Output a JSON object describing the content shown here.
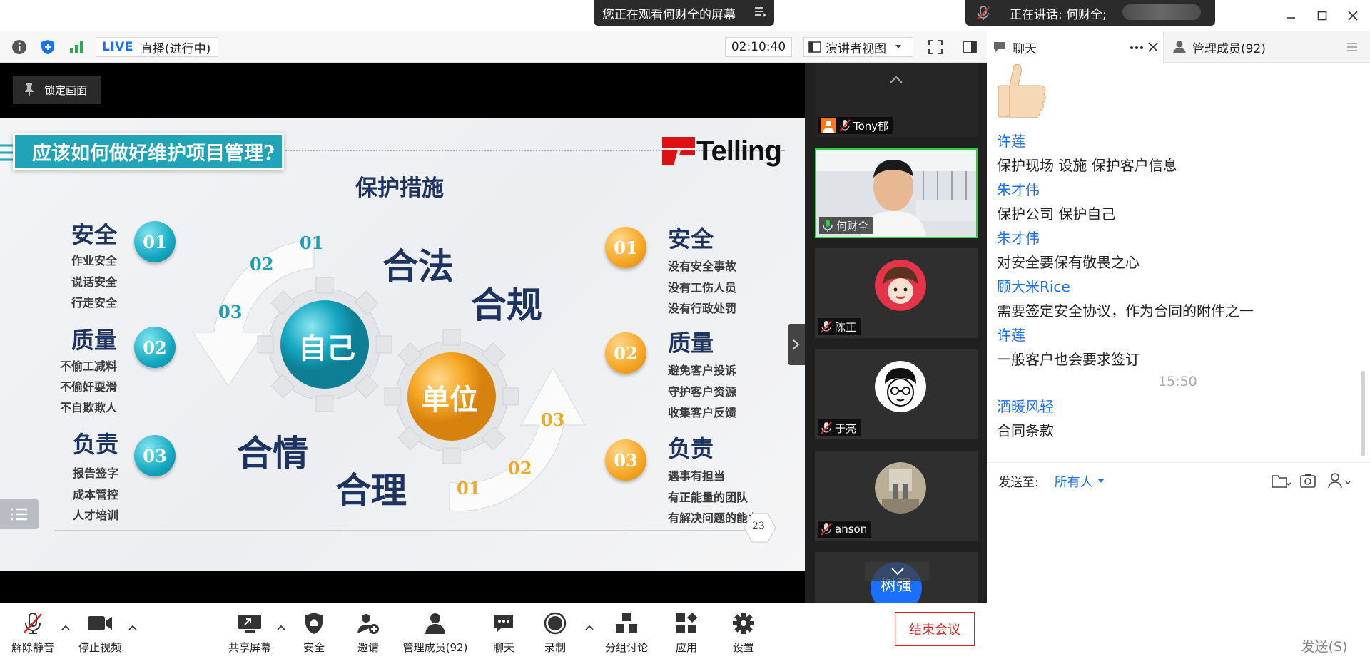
{
  "banners": {
    "sharing": "您正在观看何财全的屏幕",
    "speaking": "正在讲话: 何财全;"
  },
  "toolbar": {
    "live": "LIVE",
    "live_status": "直播(进行中)",
    "timer": "02:10:40",
    "view_mode": "演讲者视图"
  },
  "chat_header": {
    "chat_tab": "聊天",
    "members_tab": "管理成员(92)"
  },
  "slide": {
    "lock_button": "锁定画面",
    "title": "应该如何做好维护项目管理?",
    "brand": "Telling",
    "subtitle": "保护措施",
    "center_self": "自己",
    "center_unit": "单位",
    "words": [
      "合法",
      "合规",
      "合情",
      "合理"
    ],
    "arrow_numbers_left": [
      "01",
      "02",
      "03"
    ],
    "arrow_numbers_right": [
      "01",
      "02",
      "03"
    ],
    "page_number": "23",
    "left_groups": [
      {
        "title": "安全",
        "num": "01",
        "items": [
          "作业安全",
          "说话安全",
          "行走安全"
        ]
      },
      {
        "title": "质量",
        "num": "02",
        "items": [
          "不偷工减料",
          "不偷奸耍滑",
          "不自欺欺人"
        ]
      },
      {
        "title": "负责",
        "num": "03",
        "items": [
          "报告签字",
          "成本管控",
          "人才培训"
        ]
      }
    ],
    "right_groups": [
      {
        "title": "安全",
        "num": "01",
        "items": [
          "没有安全事故",
          "没有工伤人员",
          "没有行政处罚"
        ]
      },
      {
        "title": "质量",
        "num": "02",
        "items": [
          "避免客户投诉",
          "守护客户资源",
          "收集客户反馈"
        ]
      },
      {
        "title": "负责",
        "num": "03",
        "items": [
          "遇事有担当",
          "有正能量的团队",
          "有解决问题的能力"
        ]
      }
    ]
  },
  "participants": [
    {
      "name": "Tony郁"
    },
    {
      "name": "何财全"
    },
    {
      "name": "陈正"
    },
    {
      "name": "于亮"
    },
    {
      "name": "anson"
    },
    {
      "name": "树强"
    }
  ],
  "chat": {
    "messages": [
      {
        "sender": "许莲",
        "text": "保护现场 设施   保护客户信息"
      },
      {
        "sender": "朱才伟",
        "text": "保护公司  保护自己"
      },
      {
        "sender": "朱才伟",
        "text": "对安全要保有敬畏之心"
      },
      {
        "sender": "顾大米Rice",
        "text": "需要签定安全协议，作为合同的附件之一"
      },
      {
        "sender": "许莲",
        "text": "一般客户也会要求签订"
      },
      {
        "sender": "酒暖风轻",
        "text": "合同条款"
      }
    ],
    "time_divider": "15:50",
    "send_to_label": "发送至:",
    "send_to_value": "所有人",
    "send_button": "发送(S)"
  },
  "bottom_toolbar": {
    "unmute": "解除静音",
    "stop_video": "停止视频",
    "share_screen": "共享屏幕",
    "security": "安全",
    "invite": "邀请",
    "manage_members": "管理成员(92)",
    "chat": "聊天",
    "record": "录制",
    "breakout": "分组讨论",
    "apps": "应用",
    "settings": "设置",
    "end_meeting": "结束会议"
  },
  "colors": {
    "accent_blue": "#1a6fff",
    "teal": "#15a8c2",
    "orange": "#f5a623",
    "navy": "#1d3360",
    "end_red": "#e02020"
  }
}
